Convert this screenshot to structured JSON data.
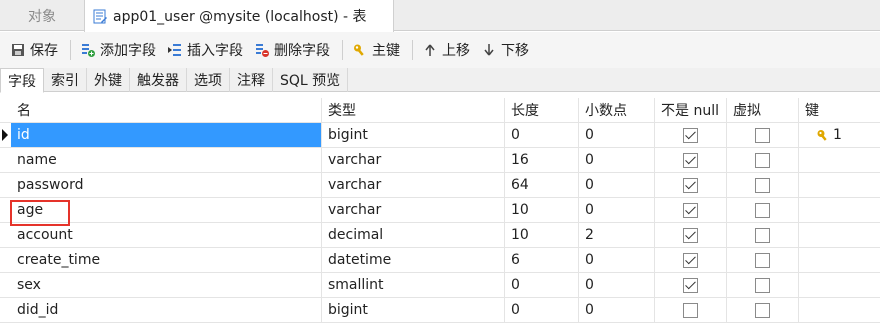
{
  "window_tabs": [
    {
      "label": "对象",
      "active": false
    },
    {
      "label": "app01_user @mysite (localhost) - 表",
      "active": true
    }
  ],
  "toolbar": {
    "save": "保存",
    "add_field": "添加字段",
    "insert_field": "插入字段",
    "delete_field": "删除字段",
    "primary_key": "主键",
    "move_up": "上移",
    "move_down": "下移"
  },
  "subtabs": [
    "字段",
    "索引",
    "外键",
    "触发器",
    "选项",
    "注释",
    "SQL 预览"
  ],
  "columns": {
    "name": "名",
    "type": "类型",
    "length": "长度",
    "decimals": "小数点",
    "not_null": "不是 null",
    "virtual": "虚拟",
    "key": "键"
  },
  "rows": [
    {
      "name": "id",
      "type": "bigint",
      "length": "0",
      "decimals": "0",
      "not_null": true,
      "virtual": false,
      "key": "1"
    },
    {
      "name": "name",
      "type": "varchar",
      "length": "16",
      "decimals": "0",
      "not_null": true,
      "virtual": false,
      "key": ""
    },
    {
      "name": "password",
      "type": "varchar",
      "length": "64",
      "decimals": "0",
      "not_null": true,
      "virtual": false,
      "key": ""
    },
    {
      "name": "age",
      "type": "varchar",
      "length": "10",
      "decimals": "0",
      "not_null": true,
      "virtual": false,
      "key": ""
    },
    {
      "name": "account",
      "type": "decimal",
      "length": "10",
      "decimals": "2",
      "not_null": true,
      "virtual": false,
      "key": ""
    },
    {
      "name": "create_time",
      "type": "datetime",
      "length": "6",
      "decimals": "0",
      "not_null": true,
      "virtual": false,
      "key": ""
    },
    {
      "name": "sex",
      "type": "smallint",
      "length": "0",
      "decimals": "0",
      "not_null": true,
      "virtual": false,
      "key": ""
    },
    {
      "name": "did_id",
      "type": "bigint",
      "length": "0",
      "decimals": "0",
      "not_null": false,
      "virtual": false,
      "key": ""
    }
  ],
  "colors": {
    "selection": "#3399ff",
    "highlight": "#e5332a",
    "key_icon": "#e0a800"
  }
}
